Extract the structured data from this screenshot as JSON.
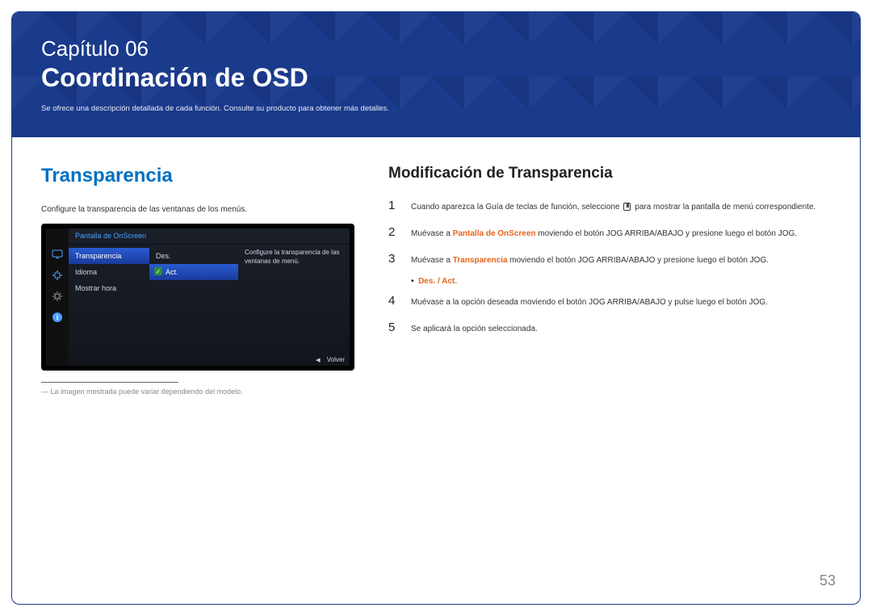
{
  "header": {
    "chapter_line": "Capítulo 06",
    "chapter_title": "Coordinación de OSD",
    "chapter_desc": "Se ofrece una descripción detallada de cada función. Consulte su producto para obtener más detalles."
  },
  "left": {
    "section_title": "Transparencia",
    "desc": "Configure la transparencia de las ventanas de los menús.",
    "footnote": "― La imagen mostrada puede variar dependiendo del modelo."
  },
  "osd": {
    "panel_title": "Pantalla de OnScreen",
    "menu1": [
      "Transparencia",
      "Idioma",
      "Mostrar hora"
    ],
    "menu2": [
      "Des.",
      "Act."
    ],
    "desc": "Configure la transparencia de las ventanas de menú.",
    "footer_back": "Volver"
  },
  "right": {
    "subheading": "Modificación de Transparencia",
    "steps": {
      "s1_a": "Cuando aparezca la Guía de teclas de función, seleccione ",
      "s1_b": " para mostrar la pantalla de menú correspondiente.",
      "s2_a": "Muévase a ",
      "s2_hl": "Pantalla de OnScreen",
      "s2_b": " moviendo el botón JOG ARRIBA/ABAJO y presione luego el botón JOG.",
      "s3_a": "Muévase a ",
      "s3_hl": "Transparencia",
      "s3_b": " moviendo el botón JOG ARRIBA/ABAJO y presione luego el botón JOG.",
      "bullet": "Des. / Act.",
      "s4": "Muévase a la opción deseada moviendo el botón JOG ARRIBA/ABAJO y pulse luego el botón JOG.",
      "s5": "Se aplicará la opción seleccionada."
    }
  },
  "page_number": "53"
}
